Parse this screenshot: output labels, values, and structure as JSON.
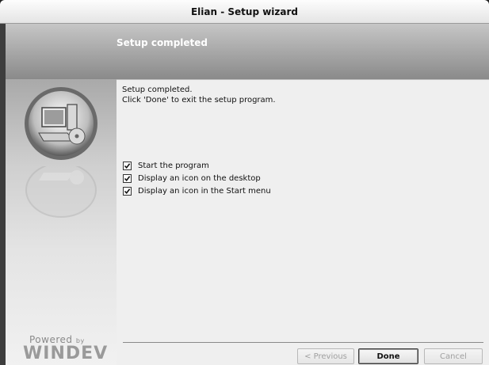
{
  "window": {
    "title": "Elian - Setup wizard"
  },
  "header": {
    "title": "Setup completed"
  },
  "content": {
    "message": "Setup completed.\nClick 'Done' to exit the setup program.",
    "options": [
      {
        "label": "Start the program",
        "checked": true
      },
      {
        "label": "Display an icon on the desktop",
        "checked": true
      },
      {
        "label": "Display an icon in the Start menu",
        "checked": true
      }
    ]
  },
  "branding": {
    "powered": "Powered",
    "by": "by",
    "product": "WINDEV"
  },
  "buttons": {
    "previous": "< Previous",
    "done": "Done",
    "cancel": "Cancel"
  }
}
